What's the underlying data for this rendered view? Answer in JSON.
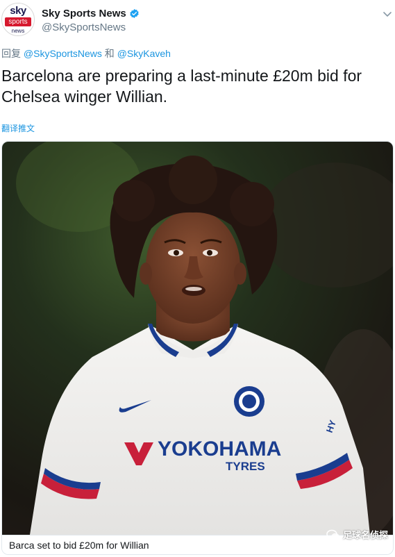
{
  "author": {
    "display_name": "Sky Sports News",
    "handle": "@SkySportsNews",
    "avatar_text": {
      "sky": "sky",
      "sports": "sports",
      "news": "news"
    },
    "verified_color": "#1da1f2"
  },
  "reply": {
    "prefix": "回复 ",
    "mention1": "@SkySportsNews",
    "connector": " 和 ",
    "mention2": "@SkyKaveh"
  },
  "tweet": {
    "text": "Barcelona are preparing a last-minute £20m bid for Chelsea winger Willian.",
    "translate_label": "翻译推文"
  },
  "media": {
    "caption": "Barca set to bid £20m for Willian",
    "sponsor_text": "YOKOHAMA",
    "sponsor_sub": "TYRES"
  },
  "watermark": {
    "text": "足球名侦探"
  },
  "colors": {
    "link": "#1b95e0",
    "muted": "#657786",
    "text": "#14171a",
    "shirt": "#f2f1ef",
    "chelsea_blue": "#1a3d8f"
  }
}
